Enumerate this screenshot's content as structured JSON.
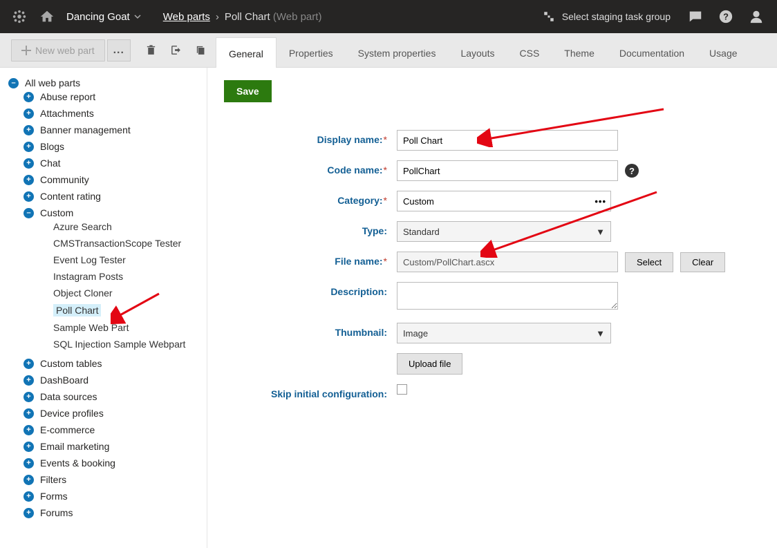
{
  "header": {
    "site_name": "Dancing Goat",
    "breadcrumb_root": "Web parts",
    "breadcrumb_current": "Poll Chart",
    "breadcrumb_paren": "(Web part)",
    "staging_label": "Select staging task group"
  },
  "toolbar": {
    "new_button": "New web part",
    "more_button": "..."
  },
  "tabs": [
    "General",
    "Properties",
    "System properties",
    "Layouts",
    "CSS",
    "Theme",
    "Documentation",
    "Usage"
  ],
  "active_tab": "General",
  "save_button": "Save",
  "tree": {
    "root": "All web parts",
    "items": [
      "Abuse report",
      "Attachments",
      "Banner management",
      "Blogs",
      "Chat",
      "Community",
      "Content rating"
    ],
    "custom_label": "Custom",
    "custom_children": [
      "Azure Search",
      "CMSTransactionScope Tester",
      "Event Log Tester",
      "Instagram Posts",
      "Object Cloner",
      "Poll Chart",
      "Sample Web Part",
      "SQL Injection Sample Webpart"
    ],
    "selected_child": "Poll Chart",
    "items_after": [
      "Custom tables",
      "DashBoard",
      "Data sources",
      "Device profiles",
      "E-commerce",
      "Email marketing",
      "Events & booking",
      "Filters",
      "Forms",
      "Forums"
    ]
  },
  "form": {
    "display_name_label": "Display name:",
    "display_name_value": "Poll Chart",
    "code_name_label": "Code name:",
    "code_name_value": "PollChart",
    "category_label": "Category:",
    "category_value": "Custom",
    "type_label": "Type:",
    "type_value": "Standard",
    "file_name_label": "File name:",
    "file_name_value": "Custom/PollChart.ascx",
    "select_btn": "Select",
    "clear_btn": "Clear",
    "description_label": "Description:",
    "thumbnail_label": "Thumbnail:",
    "thumbnail_value": "Image",
    "upload_btn": "Upload file",
    "skip_label": "Skip initial configuration:"
  }
}
